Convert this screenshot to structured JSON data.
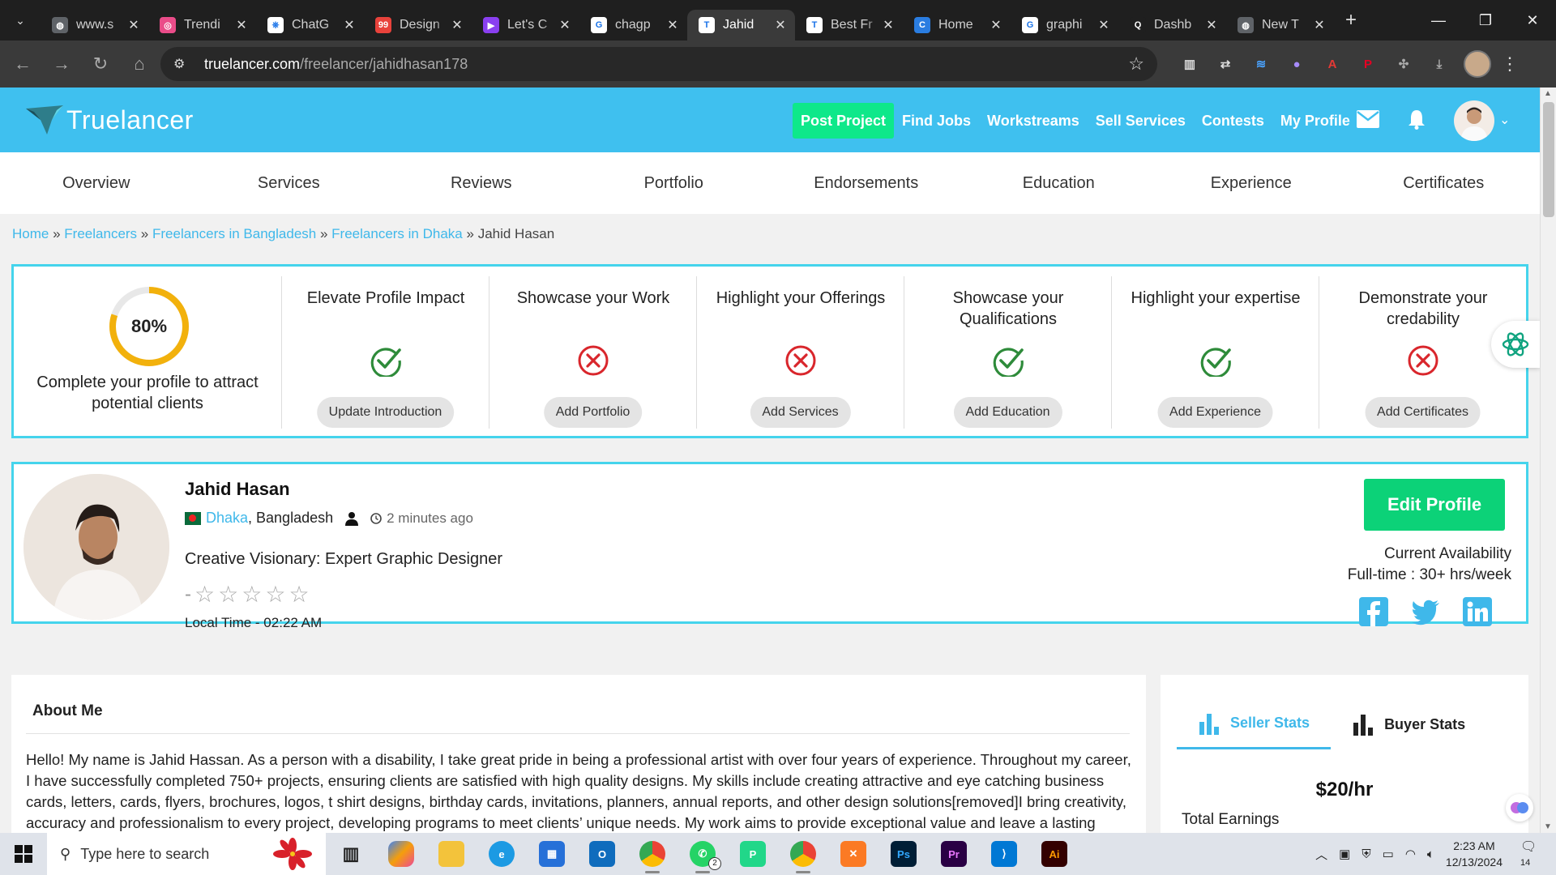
{
  "browser": {
    "tabs": [
      {
        "title": "www.s",
        "fav_color": "#5f6368",
        "fav_glyph": "◍"
      },
      {
        "title": "Trendi",
        "fav_color": "#ea4c89",
        "fav_glyph": "◎"
      },
      {
        "title": "ChatG",
        "fav_color": "#ffffff",
        "fav_glyph": "⎈"
      },
      {
        "title": "Design",
        "fav_color": "#e8423b",
        "fav_glyph": "99"
      },
      {
        "title": "Let's C",
        "fav_color": "#8a3ff0",
        "fav_glyph": "▶"
      },
      {
        "title": "chagp",
        "fav_color": "#ffffff",
        "fav_glyph": "G"
      },
      {
        "title": "Jahid",
        "fav_color": "#ffffff",
        "fav_glyph": "T",
        "active": true
      },
      {
        "title": "Best Fr",
        "fav_color": "#ffffff",
        "fav_glyph": "T"
      },
      {
        "title": "Home",
        "fav_color": "#2a7de1",
        "fav_glyph": "C"
      },
      {
        "title": "graphi",
        "fav_color": "#ffffff",
        "fav_glyph": "G"
      },
      {
        "title": "Dashb",
        "fav_color": "#1f1f1f",
        "fav_glyph": "Q"
      },
      {
        "title": "New T",
        "fav_color": "#5f6368",
        "fav_glyph": "◍"
      }
    ],
    "url_host": "truelancer.com",
    "url_path": "/freelancer/jahidhasan178"
  },
  "header": {
    "logo_text": "Truelancer",
    "post_project": "Post Project",
    "nav_links": [
      "Find Jobs",
      "Workstreams",
      "Sell Services",
      "Contests",
      "My Profile"
    ]
  },
  "profile_tabs": [
    "Overview",
    "Services",
    "Reviews",
    "Portfolio",
    "Endorsements",
    "Education",
    "Experience",
    "Certificates"
  ],
  "breadcrumb": {
    "links": [
      "Home",
      "Freelancers",
      "Freelancers in Bangladesh",
      "Freelancers in Dhaka"
    ],
    "separator": "»",
    "current": "Jahid Hasan"
  },
  "completeness": {
    "percent_label": "80%",
    "percent_value": 0.8,
    "message": "Complete your profile to attract potential clients",
    "steps": [
      {
        "title": "Elevate Profile Impact",
        "done": true,
        "button": "Update Introduction"
      },
      {
        "title": "Showcase your Work",
        "done": false,
        "button": "Add Portfolio"
      },
      {
        "title": "Highlight your Offerings",
        "done": false,
        "button": "Add Services"
      },
      {
        "title": "Showcase your Qualifications",
        "done": true,
        "button": "Add Education"
      },
      {
        "title": "Highlight your expertise",
        "done": true,
        "button": "Add Experience"
      },
      {
        "title": "Demonstrate your credability",
        "done": false,
        "button": "Add Certificates"
      }
    ]
  },
  "profile": {
    "name": "Jahid Hasan",
    "city": "Dhaka",
    "country": ", Bangladesh",
    "last_seen": "2 minutes ago",
    "title": "Creative Visionary: Expert Graphic Designer",
    "rating_prefix": "-",
    "stars": 5,
    "local_time": "Local Time - 02:22 AM",
    "edit_button": "Edit Profile",
    "availability_label": "Current Availability",
    "availability_value": "Full-time : 30+ hrs/week"
  },
  "about": {
    "title": "About Me",
    "text": "Hello! My name is Jahid Hassan. As a person with a disability, I take great pride in being a professional artist with over four years of experience. Throughout my career, I have successfully completed 750+ projects, ensuring clients are satisfied with high quality designs. My skills include creating attractive and eye catching business cards, letters, cards, flyers, brochures, logos, t shirt designs, birthday cards, invitations, planners, annual reports, and other design solutions[removed]I bring creativity, accuracy and professionalism to every project, developing programs to meet clients’ unique needs. My work aims to provide exceptional value and leave a lasting impression. Let’s work together to bring your ideas to life!"
  },
  "stats": {
    "tabs": [
      "Seller Stats",
      "Buyer Stats"
    ],
    "rate": "$20/hr",
    "total_earnings_label": "Total Earnings"
  },
  "taskbar": {
    "search_placeholder": "Type here to search",
    "time": "2:23 AM",
    "date": "12/13/2024",
    "notification_count": "14",
    "whatsapp_badge": "2"
  }
}
